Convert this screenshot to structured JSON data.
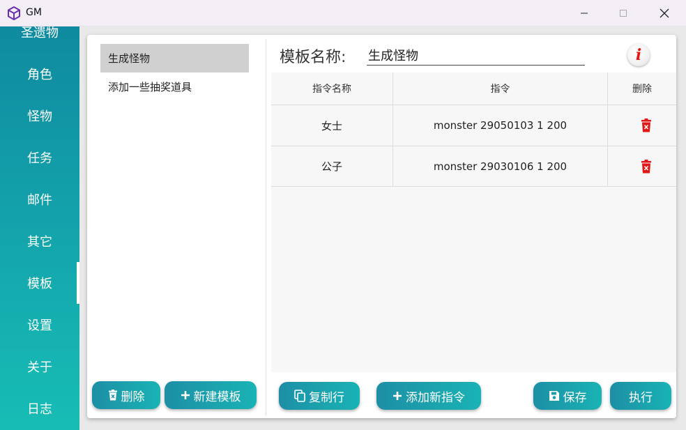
{
  "window": {
    "title": "GM"
  },
  "sidebar": {
    "items": [
      {
        "label": "圣遗物"
      },
      {
        "label": "角色"
      },
      {
        "label": "怪物"
      },
      {
        "label": "任务"
      },
      {
        "label": "邮件"
      },
      {
        "label": "其它"
      },
      {
        "label": "模板",
        "active": true
      },
      {
        "label": "设置"
      },
      {
        "label": "关于"
      },
      {
        "label": "日志"
      }
    ]
  },
  "templates": {
    "items": [
      {
        "label": "生成怪物",
        "selected": true
      },
      {
        "label": "添加一些抽奖道具"
      }
    ],
    "delete_label": "删除",
    "new_label": "新建模板"
  },
  "editor": {
    "name_label": "模板名称:",
    "name_value": "生成怪物",
    "info_glyph": "i",
    "columns": [
      "指令名称",
      "指令",
      "删除"
    ],
    "rows": [
      {
        "name": "女士",
        "command": "monster 29050103 1 200"
      },
      {
        "name": "公子",
        "command": "monster 29030106 1 200"
      }
    ],
    "copy_label": "复制行",
    "add_label": "添加新指令",
    "save_label": "保存",
    "exec_label": "执行"
  },
  "colors": {
    "accent_start": "#1d8fa5",
    "accent_end": "#19b3b5",
    "delete_icon": "#e01818",
    "info_icon": "#e01818"
  }
}
